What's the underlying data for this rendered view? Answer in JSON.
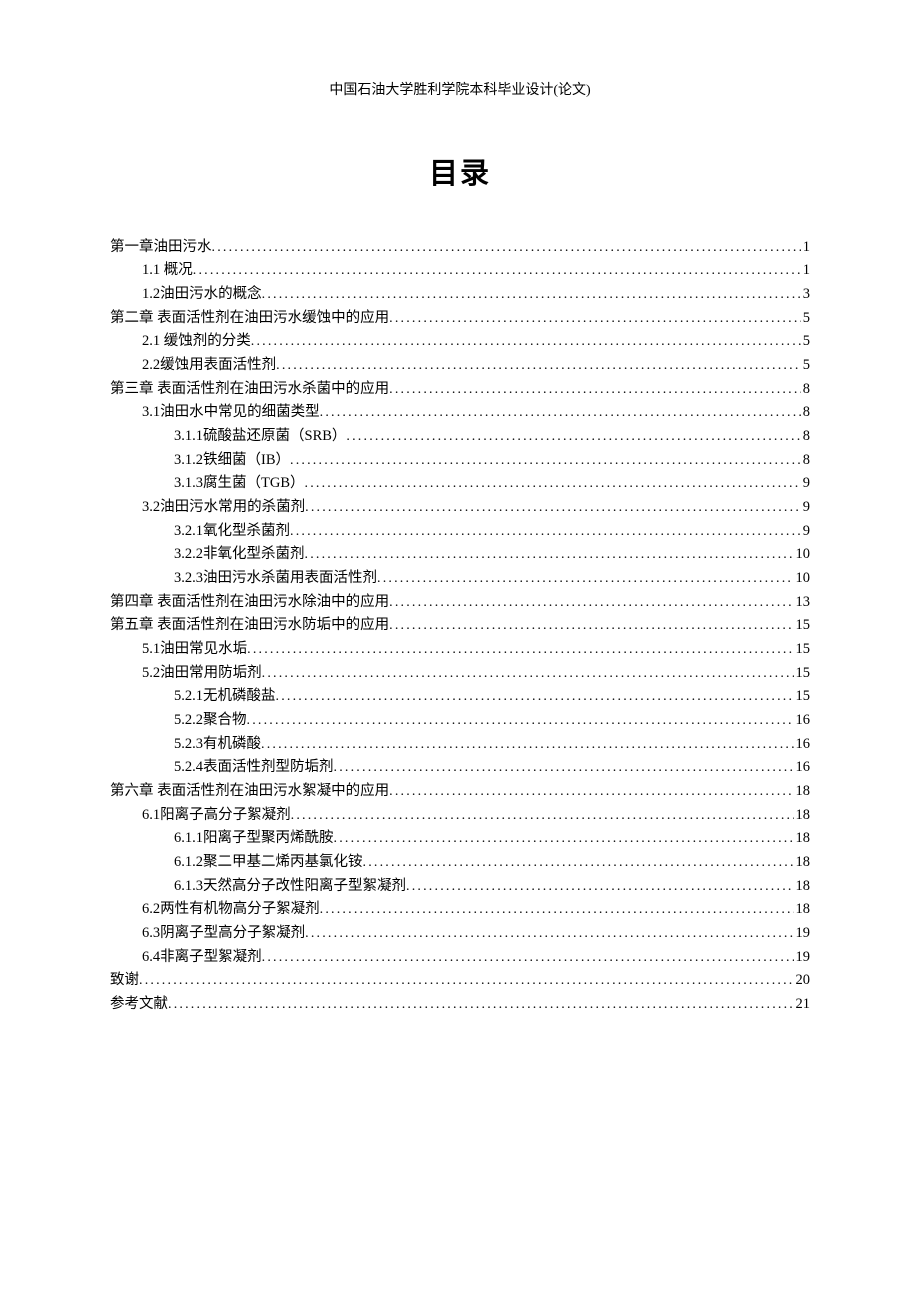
{
  "header": "中国石油大学胜利学院本科毕业设计(论文)",
  "title": "目录",
  "toc": [
    {
      "level": 1,
      "text": "第一章油田污水",
      "page": "1"
    },
    {
      "level": 2,
      "text": "1.1 概况",
      "page": "1"
    },
    {
      "level": 2,
      "text": "1.2油田污水的概念",
      "page": "3"
    },
    {
      "level": 1,
      "text": "第二章  表面活性剂在油田污水缓蚀中的应用",
      "page": "5"
    },
    {
      "level": 2,
      "text": "2.1 缓蚀剂的分类",
      "page": "5"
    },
    {
      "level": 2,
      "text": "2.2缓蚀用表面活性剂",
      "page": "5"
    },
    {
      "level": 1,
      "text": "第三章  表面活性剂在油田污水杀菌中的应用",
      "page": "8"
    },
    {
      "level": 2,
      "text": "3.1油田水中常见的细菌类型",
      "page": "8"
    },
    {
      "level": 3,
      "text": "3.1.1硫酸盐还原菌（SRB）",
      "page": "8"
    },
    {
      "level": 3,
      "text": "3.1.2铁细菌（IB）",
      "page": "8"
    },
    {
      "level": 3,
      "text": "3.1.3腐生菌（TGB）",
      "page": "9"
    },
    {
      "level": 2,
      "text": "3.2油田污水常用的杀菌剂",
      "page": "9"
    },
    {
      "level": 3,
      "text": "3.2.1氧化型杀菌剂",
      "page": "9"
    },
    {
      "level": 3,
      "text": "3.2.2非氧化型杀菌剂",
      "page": "10"
    },
    {
      "level": 3,
      "text": "3.2.3油田污水杀菌用表面活性剂",
      "page": "10"
    },
    {
      "level": 1,
      "text": "第四章 表面活性剂在油田污水除油中的应用",
      "page": "13"
    },
    {
      "level": 1,
      "text": "第五章  表面活性剂在油田污水防垢中的应用",
      "page": "15"
    },
    {
      "level": 2,
      "text": "5.1油田常见水垢",
      "page": "15"
    },
    {
      "level": 2,
      "text": "5.2油田常用防垢剂",
      "page": "15"
    },
    {
      "level": 3,
      "text": "5.2.1无机磷酸盐",
      "page": "15"
    },
    {
      "level": 3,
      "text": "5.2.2聚合物",
      "page": "16"
    },
    {
      "level": 3,
      "text": "5.2.3有机磷酸",
      "page": "16"
    },
    {
      "level": 3,
      "text": "5.2.4表面活性剂型防垢剂",
      "page": "16"
    },
    {
      "level": 1,
      "text": "第六章  表面活性剂在油田污水絮凝中的应用",
      "page": "18"
    },
    {
      "level": 2,
      "text": "6.1阳离子高分子絮凝剂",
      "page": "18"
    },
    {
      "level": 3,
      "text": "6.1.1阳离子型聚丙烯酰胺",
      "page": "18"
    },
    {
      "level": 3,
      "text": "6.1.2聚二甲基二烯丙基氯化铵",
      "page": "18"
    },
    {
      "level": 3,
      "text": "6.1.3天然高分子改性阳离子型絮凝剂",
      "page": "18"
    },
    {
      "level": 2,
      "text": "6.2两性有机物高分子絮凝剂",
      "page": "18"
    },
    {
      "level": 2,
      "text": "6.3阴离子型高分子絮凝剂",
      "page": "19"
    },
    {
      "level": 2,
      "text": "6.4非离子型絮凝剂",
      "page": "19"
    },
    {
      "level": 1,
      "text": "致谢",
      "page": "20"
    },
    {
      "level": 1,
      "text": "参考文献",
      "page": "21"
    }
  ]
}
